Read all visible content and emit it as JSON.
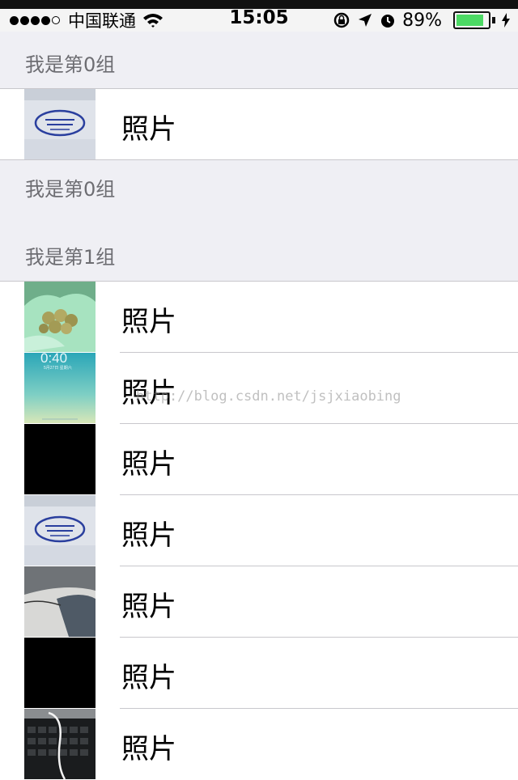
{
  "status": {
    "carrier": "中国联通",
    "time": "15:05",
    "battery_pct": "89%",
    "battery_level": 0.89,
    "signal_bars_filled": 4,
    "signal_bars_total": 5,
    "battery_color": "#4cd964"
  },
  "sections": [
    {
      "header": "我是第0组",
      "footer": "我是第0组",
      "rows": [
        {
          "label": "照片",
          "thumb": "stamp-photo"
        }
      ]
    },
    {
      "header": "我是第1组",
      "rows": [
        {
          "label": "照片",
          "thumb": "food-bag-photo"
        },
        {
          "label": "照片",
          "thumb": "lockscreen-photo"
        },
        {
          "label": "照片",
          "thumb": "black-photo"
        },
        {
          "label": "照片",
          "thumb": "stamp-photo"
        },
        {
          "label": "照片",
          "thumb": "desk-photo"
        },
        {
          "label": "照片",
          "thumb": "black-photo"
        },
        {
          "label": "照片",
          "thumb": "keyboard-photo"
        }
      ]
    }
  ],
  "lockscreen_thumb": {
    "time_text": "0:40",
    "date_text": "5月27日 星期六"
  },
  "watermark": "http://blog.csdn.net/jsjxiaobing"
}
